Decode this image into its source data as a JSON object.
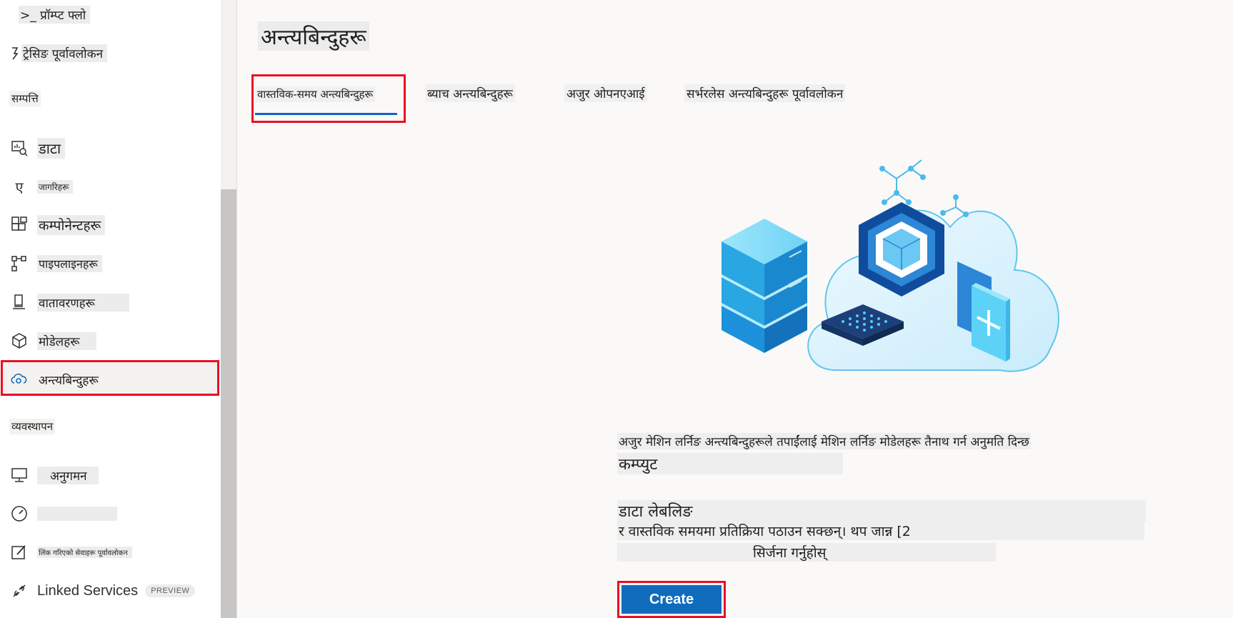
{
  "sidebar": {
    "items": [
      {
        "label": ">_ प्रॉम्प्ट फ्लो",
        "icon": "prompt-flow-icon"
      },
      {
        "label": "ट्रेसिङ पूर्वावलोकन",
        "icon": "tracing-icon"
      },
      {
        "label": "डाटा",
        "icon": "data-icon"
      },
      {
        "label": "जागरिहरू",
        "icon": "jobs-icon"
      },
      {
        "label": "कम्पोनेन्टहरू",
        "icon": "components-icon"
      },
      {
        "label": "पाइपलाइनहरू",
        "icon": "pipelines-icon"
      },
      {
        "label": "वातावरणहरू",
        "icon": "environments-icon"
      },
      {
        "label": "मोडेलहरू",
        "icon": "models-icon"
      },
      {
        "label": "अन्त्यबिन्दुहरू",
        "icon": "endpoints-icon"
      },
      {
        "label": "अनुगमन",
        "icon": "monitoring-icon"
      },
      {
        "label": "",
        "icon": "gauge-icon"
      },
      {
        "label": "लिंक गरिएको सेवाहरू पूर्वावलोकन",
        "icon": "edit-icon"
      },
      {
        "label": "Linked Services",
        "icon": "linked-services-icon",
        "badge": "PREVIEW"
      }
    ],
    "sections": {
      "assets": "सम्पत्ति",
      "manage": "व्यवस्थापन"
    }
  },
  "main": {
    "title": "अन्त्यबिन्दुहरू",
    "tabs": [
      {
        "label": "वास्तविक-समय अन्त्यबिन्दुहरू",
        "selected": true
      },
      {
        "label": "ब्याच अन्त्यबिन्दुहरू"
      },
      {
        "label": "अजुर ओपनएआई"
      },
      {
        "label": "सर्भरलेस अन्त्यबिन्दुहरू पूर्वावलोकन"
      }
    ],
    "description": {
      "line1": "अजुर मेशिन लर्निङ अन्त्यबिन्दुहरूले तपाईंलाई मेशिन लर्निङ मोडेलहरू तैनाथ गर्न अनुमति दिन्छ",
      "line2": "कम्प्युट",
      "line3": "डाटा लेबलिङ",
      "line4": "र वास्तविक समयमा प्रतिक्रिया पठाउन सक्छन्। थप जान्न [2",
      "line5": "सिर्जना गर्नुहोस्"
    },
    "create_label": "Create"
  },
  "colors": {
    "accent": "#0f6cbd",
    "highlight": "#e81123"
  }
}
